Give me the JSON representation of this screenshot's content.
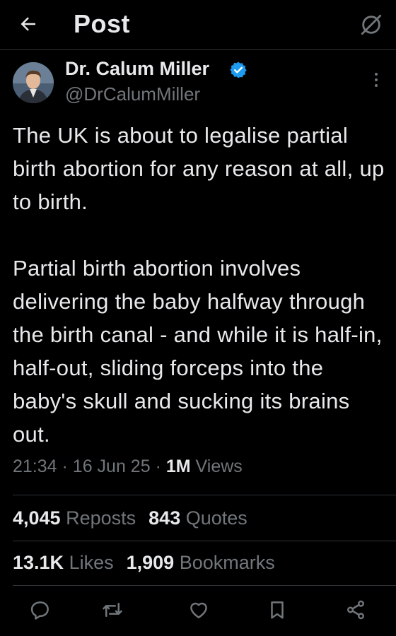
{
  "header": {
    "title": "Post",
    "back_icon": "arrow-left-icon",
    "grok_icon": "grok-icon"
  },
  "post": {
    "author": {
      "name": "Dr. Calum Miller",
      "handle": "@DrCalumMiller",
      "verified": true
    },
    "text": {
      "paragraph_1": "The UK is about to legalise partial birth abortion for any reason at all, up to birth.",
      "paragraph_2": "Partial birth abortion involves delivering the baby halfway through the birth canal - and while it is half-in, half-out, sliding forceps into the baby's skull and sucking its brains out."
    },
    "meta": {
      "time": "21:34",
      "date": "16 Jun 25",
      "separator": "·",
      "views_count": "1M",
      "views_label": "Views"
    },
    "stats": {
      "reposts_count": "4,045",
      "reposts_label": "Reposts",
      "quotes_count": "843",
      "quotes_label": "Quotes",
      "likes_count": "13.1K",
      "likes_label": "Likes",
      "bookmarks_count": "1,909",
      "bookmarks_label": "Bookmarks"
    }
  },
  "actions": [
    "reply-icon",
    "repost-icon",
    "like-icon",
    "bookmark-icon",
    "share-icon"
  ],
  "colors": {
    "background": "#000000",
    "text": "#e7e9ea",
    "secondary": "#71767b",
    "divider": "#2f3336",
    "verified": "#1d9bf0"
  }
}
